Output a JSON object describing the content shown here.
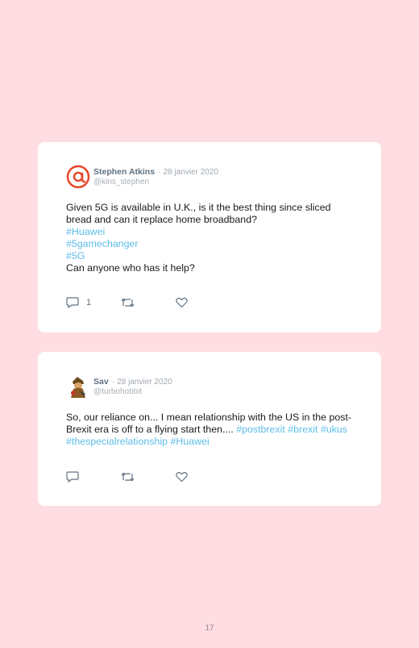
{
  "tweets": [
    {
      "author": "Stephen Atkins",
      "date": "· 28 janvier 2020",
      "handle": "@kins_stephen",
      "avatar": "at-sign-avatar",
      "lines": [
        "Given 5G is available in U.K., is it the best thing since sliced bread and can it replace home broadband?",
        "#Huawei",
        "#5gamechanger",
        "#5G",
        "Can anyone who has it help?"
      ],
      "reply_count": "1"
    },
    {
      "author": "Sav",
      "date": "· 28 janvier 2020",
      "handle": "@turbohobbit",
      "avatar": "character-avatar",
      "text": "So, our reliance on... I mean relationship with the US in the post-Brexit era is off to a flying start then.... ",
      "hashtags": [
        "#postbrexit",
        "#brexit",
        "#ukus",
        "#thespecialrelationship",
        "#Huawei"
      ],
      "reply_count": ""
    }
  ],
  "page_number": "17",
  "colors": {
    "background": "#ffdde2",
    "card": "#ffffff",
    "hashtag": "#5dbde8",
    "icon": "#607080"
  }
}
